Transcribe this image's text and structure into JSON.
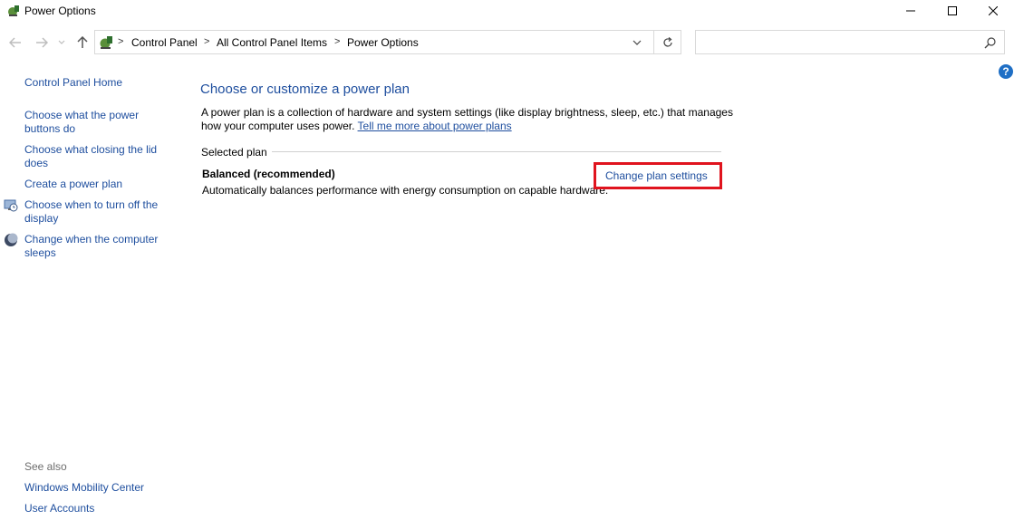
{
  "window": {
    "title": "Power Options",
    "minimize_label": "Minimize",
    "maximize_label": "Maximize",
    "close_label": "Close"
  },
  "address_bar": {
    "breadcrumbs": [
      "Control Panel",
      "All Control Panel Items",
      "Power Options"
    ],
    "separator": ">"
  },
  "search": {
    "placeholder": "",
    "value": ""
  },
  "help": {
    "label": "?"
  },
  "left_pane": {
    "home_link": "Control Panel Home",
    "tasks": [
      {
        "label": "Choose what the power buttons do",
        "icon": ""
      },
      {
        "label": "Choose what closing the lid does",
        "icon": ""
      },
      {
        "label": "Create a power plan",
        "icon": ""
      },
      {
        "label": "Choose when to turn off the display",
        "icon": "display-clock-icon"
      },
      {
        "label": "Change when the computer sleeps",
        "icon": "moon-icon"
      }
    ],
    "see_also": {
      "heading": "See also",
      "links": [
        "Windows Mobility Center",
        "User Accounts"
      ]
    }
  },
  "main": {
    "heading": "Choose or customize a power plan",
    "intro_text": "A power plan is a collection of hardware and system settings (like display brightness, sleep, etc.) that manages how your computer uses power.",
    "intro_link": "Tell me more about power plans",
    "section_label": "Selected plan",
    "plan": {
      "name": "Balanced (recommended)",
      "description": "Automatically balances performance with energy consumption on capable hardware.",
      "change_link": "Change plan settings"
    }
  },
  "colors": {
    "link": "#1e4e9e",
    "highlight_border": "#e0141e",
    "help_bg": "#1f6fc5"
  }
}
